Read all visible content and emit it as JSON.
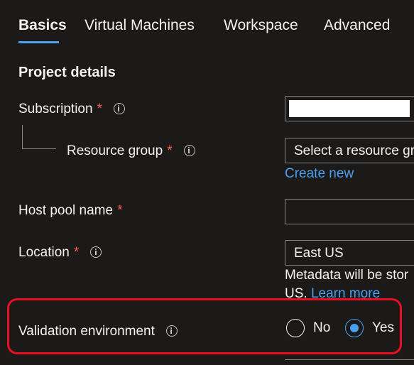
{
  "tabs": [
    {
      "label": "Basics"
    },
    {
      "label": "Virtual Machines"
    },
    {
      "label": "Workspace"
    },
    {
      "label": "Advanced"
    }
  ],
  "section": {
    "title": "Project details"
  },
  "form": {
    "required_mark": "*",
    "subscription": {
      "label": "Subscription",
      "value": ""
    },
    "resource_group": {
      "label": "Resource group",
      "placeholder": "Select a resource gr",
      "create_new": "Create new"
    },
    "host_pool_name": {
      "label": "Host pool name",
      "value": ""
    },
    "location": {
      "label": "Location",
      "value": "East US",
      "note_line1": "Metadata will be stor",
      "note_line2_prefix": "US.",
      "learn_more": "Learn more"
    },
    "validation_environment": {
      "label": "Validation environment",
      "options": [
        {
          "label": "No",
          "selected": false
        },
        {
          "label": "Yes",
          "selected": true
        }
      ]
    }
  },
  "colors": {
    "background": "#1b1a19",
    "accent": "#4aa0f0",
    "required": "#ff5a4a",
    "highlight_border": "#e81123"
  }
}
